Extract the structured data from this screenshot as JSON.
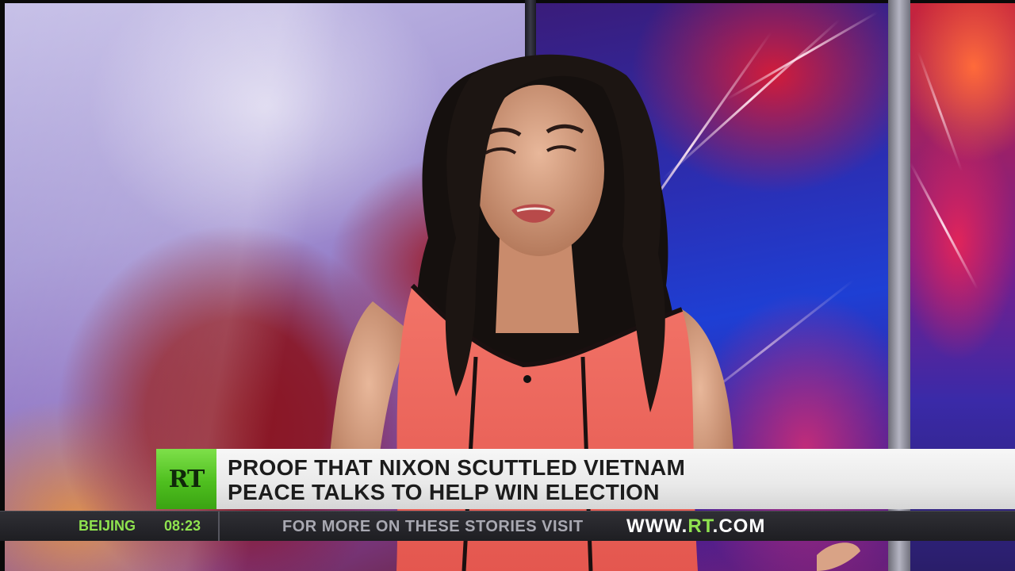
{
  "broadcast": {
    "logo": "RT",
    "headline": {
      "line1": "PROOF THAT NIXON SCUTTLED VIETNAM",
      "line2": "PEACE TALKS TO HELP WIN ELECTION"
    },
    "ticker": {
      "city": "BEIJING",
      "time": "08:23",
      "visit_text": "FOR MORE ON THESE STORIES VISIT",
      "url_prefix": "WWW.",
      "url_brand": "RT",
      "url_suffix": ".COM"
    }
  },
  "colors": {
    "brand_green": "#5ccc2a",
    "ticker_green": "#8fe34f",
    "headline_bg": "#eeeeee",
    "ticker_bg": "#26262b",
    "dress": "#f0625e"
  }
}
